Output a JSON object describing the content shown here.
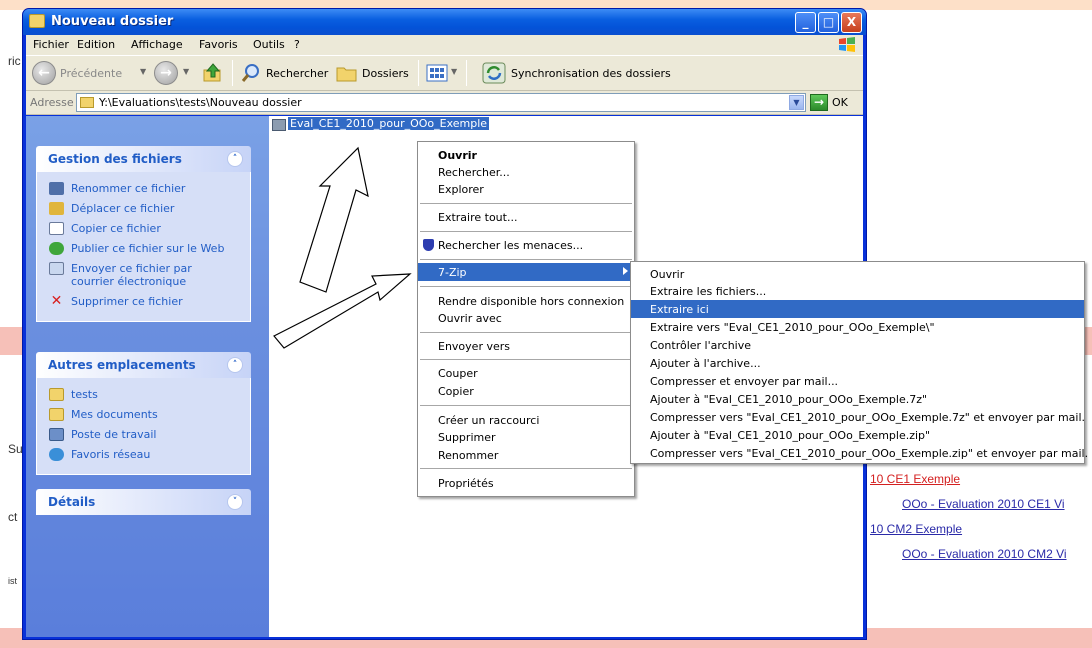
{
  "window": {
    "title": "Nouveau dossier",
    "buttons": {
      "minimize": "_",
      "maximize": "□",
      "close": "X"
    }
  },
  "menubar": [
    "Fichier",
    "Edition",
    "Affichage",
    "Favoris",
    "Outils",
    "?"
  ],
  "toolbar": {
    "back": "Précédente",
    "search": "Rechercher",
    "folders": "Dossiers",
    "sync": "Synchronisation des dossiers"
  },
  "address": {
    "label": "Adresse",
    "path": "Y:\\Evaluations\\tests\\Nouveau dossier",
    "go": "OK"
  },
  "left_pane": {
    "file_tasks": {
      "title": "Gestion des fichiers",
      "items": [
        "Renommer ce fichier",
        "Déplacer ce fichier",
        "Copier ce fichier",
        "Publier ce fichier sur le Web",
        "Envoyer ce fichier par courrier électronique",
        "Supprimer ce fichier"
      ]
    },
    "other_places": {
      "title": "Autres emplacements",
      "items": [
        "tests",
        "Mes documents",
        "Poste de travail",
        "Favoris réseau"
      ]
    },
    "details": {
      "title": "Détails"
    }
  },
  "file": {
    "name": "Eval_CE1_2010_pour_OOo_Exemple"
  },
  "context_menu": {
    "items": [
      "Ouvrir",
      "Rechercher...",
      "Explorer",
      "Extraire tout...",
      "Rechercher les menaces...",
      "7-Zip",
      "Rendre disponible hors connexion",
      "Ouvrir avec",
      "Envoyer vers",
      "Couper",
      "Copier",
      "Créer un raccourci",
      "Supprimer",
      "Renommer",
      "Propriétés"
    ]
  },
  "zip_menu": {
    "items": [
      "Ouvrir",
      "Extraire les fichiers...",
      "Extraire ici",
      "Extraire vers \"Eval_CE1_2010_pour_OOo_Exemple\\\"",
      "Contrôler l'archive",
      "Ajouter à l'archive...",
      "Compresser et envoyer par mail...",
      "Ajouter à \"Eval_CE1_2010_pour_OOo_Exemple.7z\"",
      "Compresser vers \"Eval_CE1_2010_pour_OOo_Exemple.7z\" et envoyer par mail.",
      "Ajouter à \"Eval_CE1_2010_pour_OOo_Exemple.zip\"",
      "Compresser vers \"Eval_CE1_2010_pour_OOo_Exemple.zip\" et envoyer par mail."
    ],
    "highlighted": "Extraire ici"
  },
  "background": {
    "fragments": [
      "ric",
      "Su",
      "ct",
      "ist"
    ],
    "links": [
      "10 CE1 Exemple",
      "OOo - Evaluation 2010 CE1 Vi",
      "10 CM2 Exemple",
      "OOo - Evaluation 2010 CM2 Vi"
    ]
  },
  "colors": {
    "titlebar": "#0a5fe0",
    "left_pane": "#6a8fdf",
    "selection": "#316ac5",
    "link": "#2a2aa8",
    "link_red": "#d42020"
  }
}
